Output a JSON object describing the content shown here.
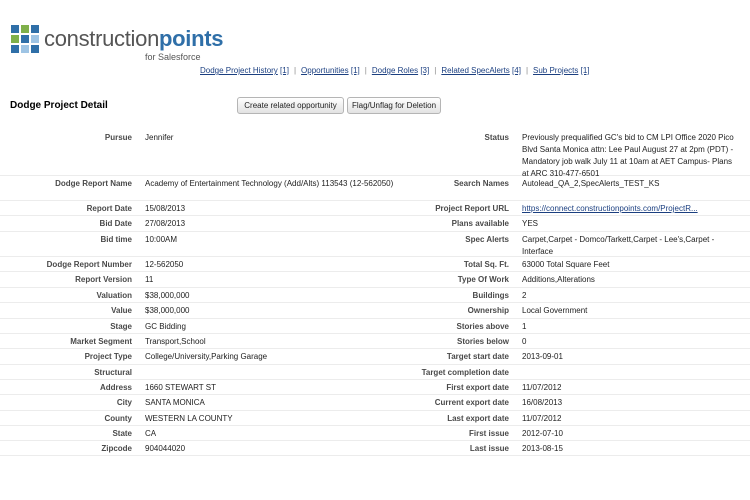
{
  "header": {
    "brand_main": "construction",
    "brand_bold": "points",
    "brand_sub": "for Salesforce",
    "colors": {
      "brand_gray": "#555555",
      "brand_blue": "#2f6fa8",
      "link": "#1b3f80"
    }
  },
  "related_links": [
    {
      "label": "Dodge Project History",
      "count": "[1]"
    },
    {
      "label": "Opportunities",
      "count": "[1]"
    },
    {
      "label": "Dodge Roles",
      "count": "[3]"
    },
    {
      "label": "Related SpecAlerts",
      "count": "[4]"
    },
    {
      "label": "Sub Projects",
      "count": "[1]"
    }
  ],
  "detail": {
    "title": "Dodge Project Detail",
    "buttons": {
      "create_opportunity": "Create related opportunity",
      "flag": "Flag/Unflag for Deletion"
    }
  },
  "fields": [
    {
      "left_label": "Pursue",
      "left_value": "Jennifer",
      "right_label": "Status",
      "right_value": "Previously prequalified GC's bid to CM LPI Office 2020 Pico Blvd Santa Monica attn: Lee Paul August 27 at 2pm (PDT) - Mandatory job walk July 11 at 10am at AET Campus- Plans at ARC 310-477-6501"
    },
    {
      "left_label": "Dodge Report Name",
      "left_value": "Academy of Entertainment Technology (Add/Alts) 113543 (12-562050)",
      "right_label": "Search Names",
      "right_value": "Autolead_QA_2,SpecAlerts_TEST_KS"
    },
    {
      "left_label": "Report Date",
      "left_value": "15/08/2013",
      "right_label": "Project Report URL",
      "right_value": "https://connect.constructionpoints.com/ProjectR...",
      "right_link": true
    },
    {
      "left_label": "Bid Date",
      "left_value": "27/08/2013",
      "right_label": "Plans available",
      "right_value": "YES"
    },
    {
      "left_label": "Bid time",
      "left_value": "10:00AM",
      "right_label": "Spec Alerts",
      "right_value": "Carpet,Carpet - Domco/Tarkett,Carpet - Lee's,Carpet - Interface"
    },
    {
      "left_label": "Dodge Report Number",
      "left_value": "12-562050",
      "right_label": "Total Sq. Ft.",
      "right_value": "63000 Total Square Feet"
    },
    {
      "left_label": "Report Version",
      "left_value": "11",
      "right_label": "Type Of Work",
      "right_value": "Additions,Alterations"
    },
    {
      "left_label": "Valuation",
      "left_value": "$38,000,000",
      "right_label": "Buildings",
      "right_value": "2"
    },
    {
      "left_label": "Value",
      "left_value": "$38,000,000",
      "right_label": "Ownership",
      "right_value": "Local Government"
    },
    {
      "left_label": "Stage",
      "left_value": "GC Bidding",
      "right_label": "Stories above",
      "right_value": "1"
    },
    {
      "left_label": "Market Segment",
      "left_value": "Transport,School",
      "right_label": "Stories below",
      "right_value": "0"
    },
    {
      "left_label": "Project Type",
      "left_value": "College/University,Parking Garage",
      "right_label": "Target start date",
      "right_value": "2013-09-01"
    },
    {
      "left_label": "Structural",
      "left_value": "",
      "right_label": "Target completion date",
      "right_value": ""
    },
    {
      "left_label": "Address",
      "left_value": "1660 STEWART ST",
      "right_label": "First export date",
      "right_value": "11/07/2012"
    },
    {
      "left_label": "City",
      "left_value": "SANTA MONICA",
      "right_label": "Current export date",
      "right_value": "16/08/2013"
    },
    {
      "left_label": "County",
      "left_value": "WESTERN LA COUNTY",
      "right_label": "Last export date",
      "right_value": "11/07/2012"
    },
    {
      "left_label": "State",
      "left_value": "CA",
      "right_label": "First issue",
      "right_value": "2012-07-10"
    },
    {
      "left_label": "Zipcode",
      "left_value": "904044020",
      "right_label": "Last issue",
      "right_value": "2013-08-15"
    }
  ]
}
